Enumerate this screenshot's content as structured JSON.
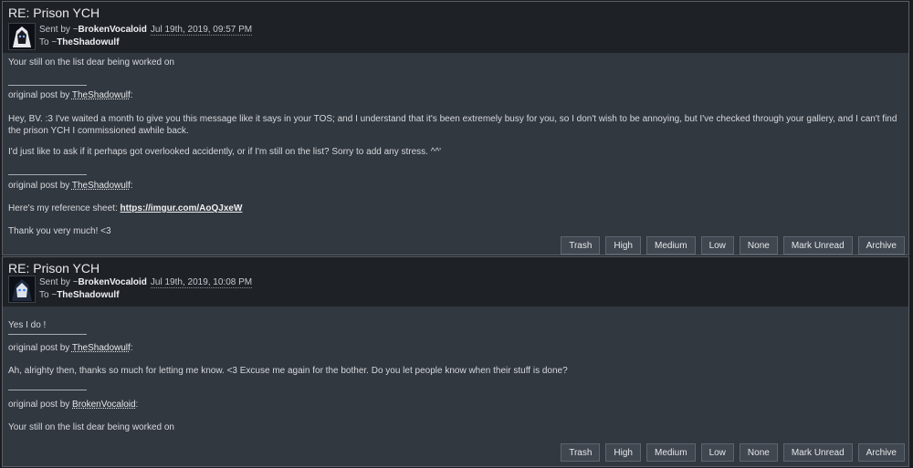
{
  "notes": [
    {
      "title": "RE: Prison YCH",
      "sent_prefix": "Sent by ~",
      "sender": "BrokenVocaloid",
      "date": "Jul 19th, 2019, 09:57 PM",
      "to_prefix": "To ~",
      "recipient": "TheShadowulf",
      "body": {
        "reply": "Your still on the list dear being worked on",
        "q1_prefix": "original post by ",
        "q1_author": "TheShadowulf",
        "q1_text_a": "Hey, BV. :3 I've waited a month to give you this message like it says in your TOS; and I understand that it's been extremely busy for you, so I don't wish to be annoying, but I've checked through your gallery, and I can't find the prison YCH I commissioned awhile back.",
        "q1_text_b": "I'd just like to ask if it perhaps got overlooked accidently, or if I'm still on the list? Sorry to add any stress. ^^'",
        "q2_prefix": "original post by ",
        "q2_author": "TheShadowulf",
        "q2_ref_label": "Here's my reference sheet: ",
        "q2_ref_link": "https://imgur.com/AoQJxeW",
        "q2_thanks": "Thank you very much! <3"
      }
    },
    {
      "title": "RE: Prison YCH",
      "sent_prefix": "Sent by ~",
      "sender": "BrokenVocaloid",
      "date": "Jul 19th, 2019, 10:08 PM",
      "to_prefix": "To ~",
      "recipient": "TheShadowulf",
      "body": {
        "reply": "Yes I do !",
        "q1_prefix": "original post by ",
        "q1_author": "TheShadowulf",
        "q1_text": "Ah, alrighty then, thanks so much for letting me know. <3 Excuse me again for the bother. Do you let people know when their stuff is done?",
        "q2_prefix": "original post by ",
        "q2_author": "BrokenVocaloid",
        "q2_text": "Your still on the list dear being worked on"
      }
    }
  ],
  "buttons": {
    "trash": "Trash",
    "high": "High",
    "medium": "Medium",
    "low": "Low",
    "none": "None",
    "mark_unread": "Mark Unread",
    "archive": "Archive"
  },
  "colors": {
    "header_bg": "#1e2126",
    "body_bg": "#32383f",
    "page_bg": "#1b1d21"
  }
}
